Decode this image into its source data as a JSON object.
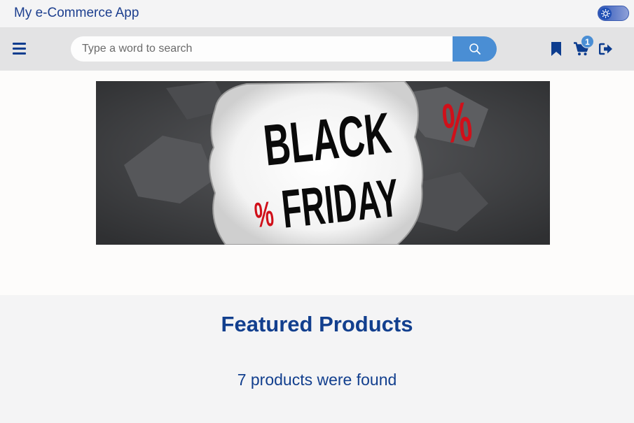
{
  "app": {
    "title": "My e-Commerce App"
  },
  "theme_toggle": {
    "icon": "sun-icon",
    "state": "on"
  },
  "navbar": {
    "menu_icon": "hamburger-menu-icon",
    "search": {
      "placeholder": "Type a word to search",
      "value": "",
      "button_icon": "search-icon"
    },
    "bookmark_icon": "bookmark-icon",
    "cart": {
      "icon": "cart-icon",
      "count": "1"
    },
    "logout_icon": "logout-icon"
  },
  "banner": {
    "line1": "BLACK",
    "line2": "FRIDAY",
    "percent_symbol": "%",
    "accent_color": "#d0101a"
  },
  "featured": {
    "title": "Featured Products",
    "count_text": "7 products were found"
  }
}
